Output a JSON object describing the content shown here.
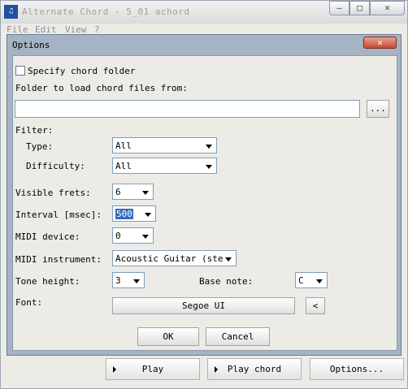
{
  "window": {
    "icon": "app-icon",
    "title": "Alternate Chord - 5_01 achord",
    "minimize": "–",
    "maximize": "□",
    "close": "✕"
  },
  "menu": [
    "File",
    "Edit",
    "View",
    "?"
  ],
  "dialog": {
    "title": "Options",
    "close": "✕",
    "specify_folder_label": "Specify chord folder",
    "specify_folder_checked": false,
    "folder_label": "Folder to load chord files from:",
    "folder_value": "",
    "browse_label": "...",
    "filter_label": "Filter:",
    "type_label": "Type:",
    "type_value": "All",
    "difficulty_label": "Difficulty:",
    "difficulty_value": "All",
    "visible_frets_label": "Visible frets:",
    "visible_frets_value": "6",
    "interval_label": "Interval [msec]:",
    "interval_value": "500",
    "midi_device_label": "MIDI device:",
    "midi_device_value": "0",
    "midi_instrument_label": "MIDI instrument:",
    "midi_instrument_value": "Acoustic Guitar (steel)",
    "tone_height_label": "Tone height:",
    "tone_height_value": "3",
    "base_note_label": "Base note:",
    "base_note_value": "C",
    "font_label": "Font:",
    "font_value": "Segoe UI",
    "font_small_button": "<",
    "ok_label": "OK",
    "cancel_label": "Cancel"
  },
  "main_buttons": {
    "play": "Play",
    "play_chord": "Play chord",
    "options": "Options..."
  }
}
